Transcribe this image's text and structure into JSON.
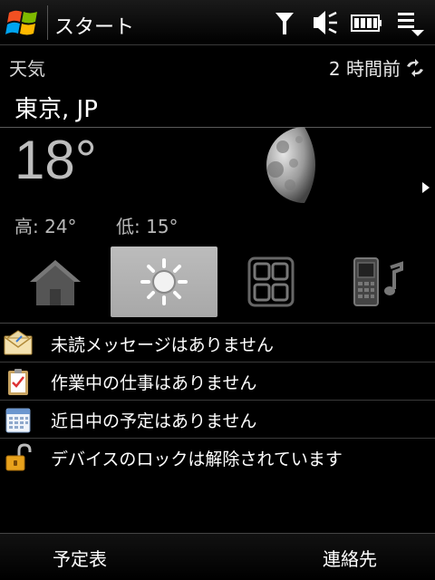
{
  "titlebar": {
    "title": "スタート",
    "icons": [
      "windows-start-icon",
      "antenna-icon",
      "volume-icon",
      "battery-icon",
      "menu-icon"
    ]
  },
  "weather": {
    "label": "天気",
    "updated": "2 時間前",
    "city": "東京, JP",
    "temperature": "18°",
    "high": "高: 24°",
    "low": "低: 15°",
    "condition_icon": "moon-icon"
  },
  "tabs": [
    {
      "icon": "home-icon",
      "selected": false
    },
    {
      "icon": "weather-sun-icon",
      "selected": true
    },
    {
      "icon": "apps-grid-icon",
      "selected": false
    },
    {
      "icon": "phone-music-icon",
      "selected": false
    }
  ],
  "list": [
    {
      "icon": "envelope-icon",
      "text": "未読メッセージはありません"
    },
    {
      "icon": "clipboard-icon",
      "text": "作業中の仕事はありません"
    },
    {
      "icon": "calendar-icon",
      "text": "近日中の予定はありません"
    },
    {
      "icon": "unlocked-padlock-icon",
      "text": "デバイスのロックは解除されています"
    }
  ],
  "softkeys": {
    "left": "予定表",
    "right": "連絡先"
  }
}
